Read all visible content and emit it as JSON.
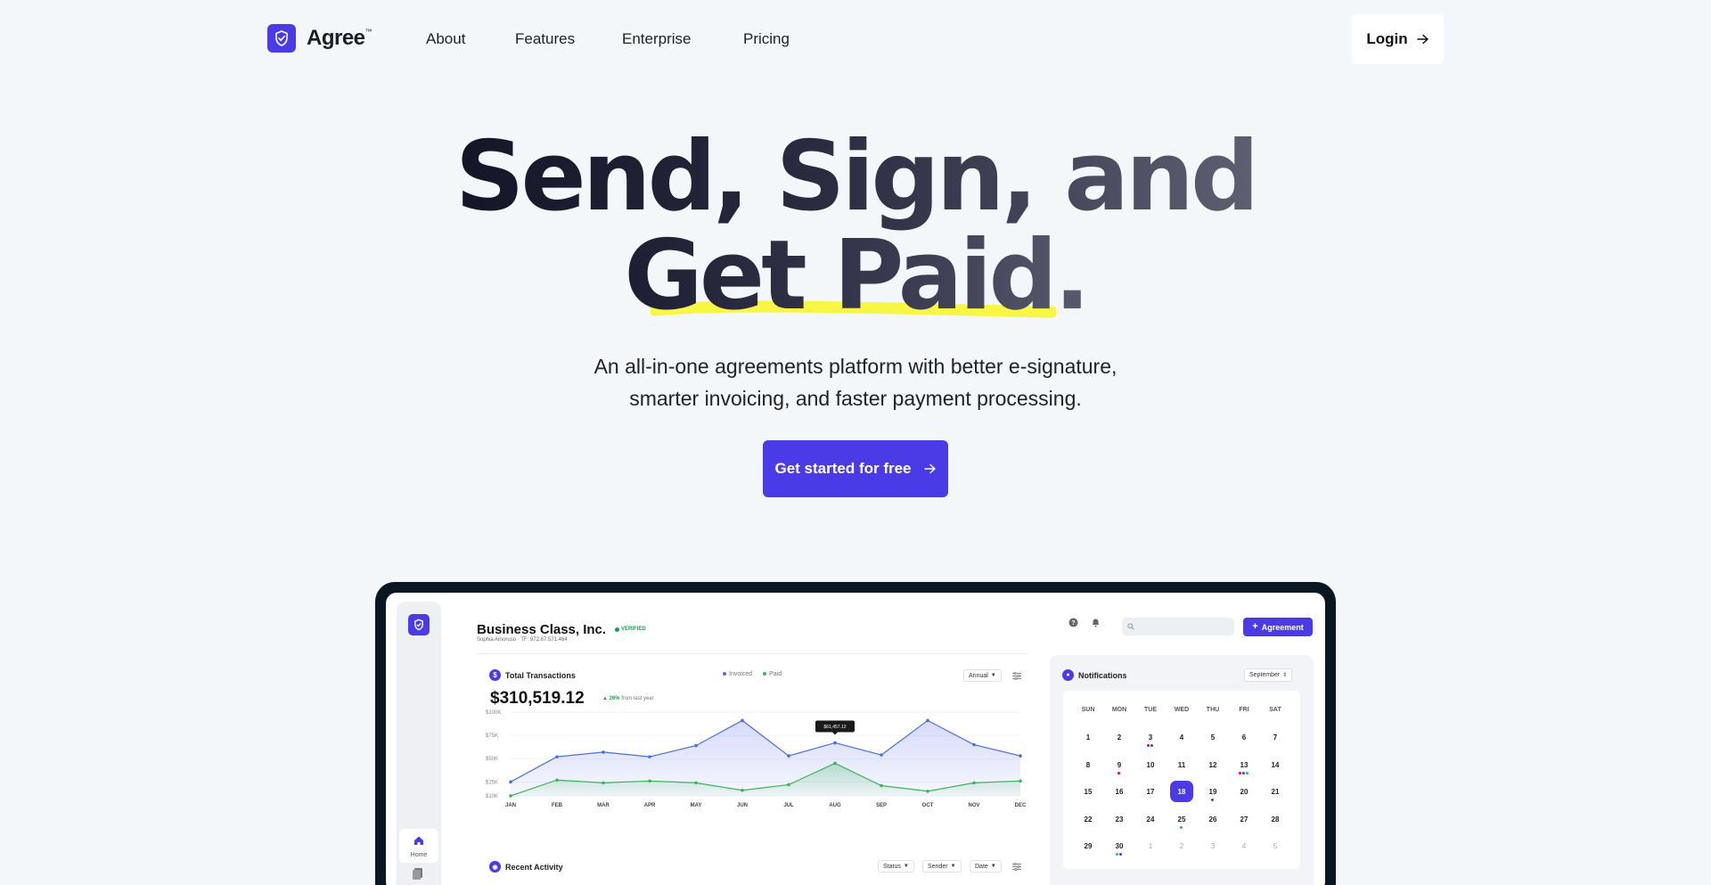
{
  "brand": {
    "name": "Agree",
    "tm": "™"
  },
  "nav": {
    "about": "About",
    "features": "Features",
    "enterprise": "Enterprise",
    "pricing": "Pricing",
    "login": "Login"
  },
  "hero": {
    "line1": "Send, Sign, and",
    "line2": "Get Paid.",
    "sub1": "An all-in-one agreements platform with better e-signature,",
    "sub2": "smarter invoicing, and faster payment processing.",
    "cta": "Get started for free"
  },
  "colors": {
    "accent": "#4b3be6",
    "highlight": "#f7f53a",
    "invoiced": "#4a6ee0",
    "paid": "#3bb55b"
  },
  "app": {
    "company": "Business Class, Inc.",
    "verified": "VERIFIED",
    "owner": "Sophia Amoruso · TF: 972.67.571.464",
    "agreement_btn": "Agreement",
    "transactions_title": "Total Transactions",
    "legend_invoiced": "Invoiced",
    "legend_paid": "Paid",
    "period": "Annual",
    "total": "$310,519.12",
    "growth_pct": "26%",
    "growth_text": "from last year",
    "tooltip": "$61,457.12",
    "notifications_title": "Notifications",
    "month": "September",
    "recent_title": "Recent Activity",
    "filter_status": "Status",
    "filter_sender": "Sender",
    "filter_date": "Date",
    "home_label": "Home"
  },
  "calendar": {
    "days_of_week": [
      "SUN",
      "MON",
      "TUE",
      "WED",
      "THU",
      "FRI",
      "SAT"
    ],
    "weeks": [
      [
        "1",
        "2",
        "3",
        "4",
        "5",
        "6",
        "7"
      ],
      [
        "8",
        "9",
        "10",
        "11",
        "12",
        "13",
        "14"
      ],
      [
        "15",
        "16",
        "17",
        "18",
        "19",
        "20",
        "21"
      ],
      [
        "22",
        "23",
        "24",
        "25",
        "26",
        "27",
        "28"
      ],
      [
        "29",
        "30",
        "1",
        "2",
        "3",
        "4",
        "5"
      ]
    ],
    "selected": "18"
  },
  "chart_data": {
    "type": "line",
    "categories": [
      "JAN",
      "FEB",
      "MAR",
      "APR",
      "MAY",
      "JUN",
      "JUL",
      "AUG",
      "SEP",
      "OCT",
      "NOV",
      "DEC"
    ],
    "y_ticks": [
      "$100K",
      "$75K",
      "$50K",
      "$25K",
      "$10K"
    ],
    "series": [
      {
        "name": "Invoiced",
        "values": [
          25,
          52,
          57,
          52,
          64,
          91,
          53,
          67,
          54,
          91,
          65,
          53
        ]
      },
      {
        "name": "Paid",
        "values": [
          10,
          27,
          24,
          26,
          24,
          16,
          22,
          45,
          21,
          15,
          24,
          26
        ]
      }
    ]
  }
}
